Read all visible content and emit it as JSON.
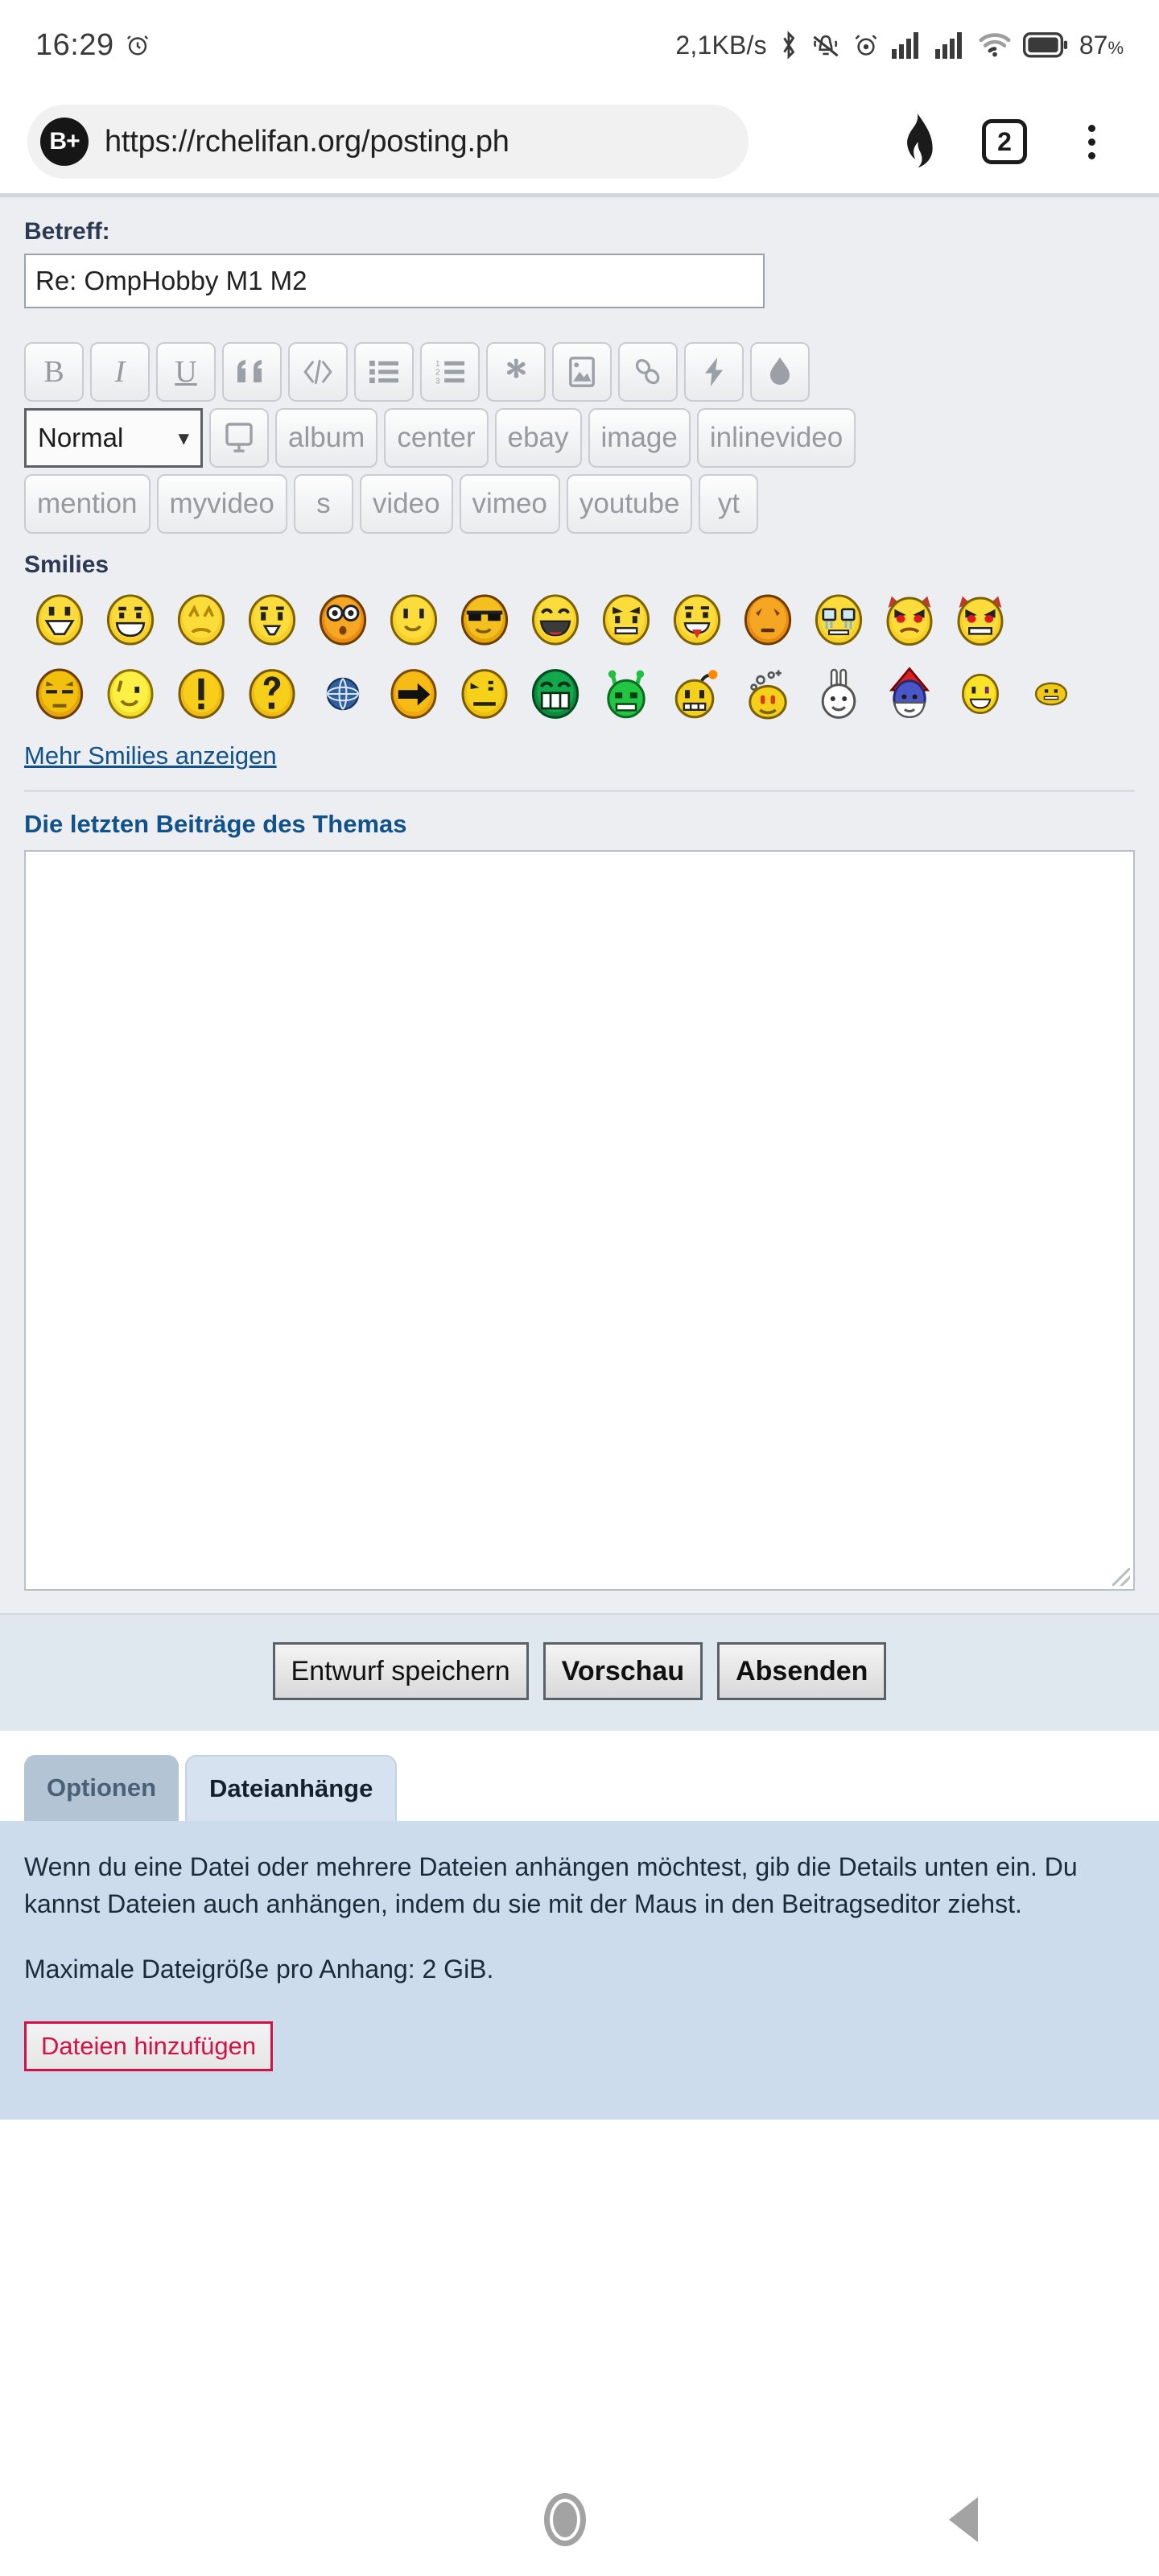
{
  "status_bar": {
    "time": "16:29",
    "alarm_icon": "alarm-clock-icon",
    "network_speed": "2,1KB/s",
    "icons": [
      "bluetooth-icon",
      "vibrate-off-icon",
      "alarm-icon",
      "signal-sim1-icon",
      "signal-sim2-icon",
      "wifi-icon",
      "battery-icon"
    ],
    "battery_percent": "87",
    "battery_percent_symbol": "%"
  },
  "browser": {
    "profile_badge": "B+",
    "url": "https://rchelifan.org/posting.ph",
    "shields_icon": "brave-shields-flame-icon",
    "tab_count": "2",
    "menu_icon": "kebab-menu-icon"
  },
  "form": {
    "subject_label": "Betreff:",
    "subject_value": "Re: OmpHobby M1 M2"
  },
  "toolbar": {
    "row1": [
      {
        "name": "bold-button",
        "glyph": "B"
      },
      {
        "name": "italic-button",
        "glyph": "I"
      },
      {
        "name": "underline-button",
        "glyph": "U"
      },
      {
        "name": "quote-button",
        "glyph": "“"
      },
      {
        "name": "code-button",
        "glyph": "</>"
      },
      {
        "name": "unordered-list-button",
        "glyph": "list"
      },
      {
        "name": "ordered-list-button",
        "glyph": "list-ordered"
      },
      {
        "name": "list-item-button",
        "glyph": "✳"
      },
      {
        "name": "image-button",
        "glyph": "image"
      },
      {
        "name": "url-link-button",
        "glyph": "link"
      },
      {
        "name": "flash-button",
        "glyph": "⚡"
      },
      {
        "name": "color-button",
        "glyph": "droplet"
      }
    ],
    "font_size_select": "Normal",
    "row2": [
      {
        "name": "screen-button",
        "glyph": "monitor"
      },
      {
        "name": "album-button",
        "glyph": "album"
      },
      {
        "name": "center-button",
        "glyph": "center"
      },
      {
        "name": "ebay-button",
        "glyph": "ebay"
      },
      {
        "name": "image-tag-button",
        "glyph": "image"
      },
      {
        "name": "inlinevideo-button",
        "glyph": "inlinevideo"
      }
    ],
    "row3": [
      {
        "name": "mention-button",
        "glyph": "mention"
      },
      {
        "name": "myvideo-button",
        "glyph": "myvideo"
      },
      {
        "name": "strike-button",
        "glyph": "s"
      },
      {
        "name": "video-button",
        "glyph": "video"
      },
      {
        "name": "vimeo-button",
        "glyph": "vimeo"
      },
      {
        "name": "youtube-button",
        "glyph": "youtube"
      },
      {
        "name": "yt-button",
        "glyph": "yt"
      }
    ]
  },
  "smilies": {
    "heading": "Smilies",
    "more_link": "Mehr Smilies anzeigen",
    "row1": [
      "smiley-big-grin",
      "smiley-grin",
      "smiley-sad",
      "smiley-tongue-out",
      "smiley-shocked",
      "smiley-smile",
      "smiley-cool",
      "smiley-laugh",
      "smiley-mad",
      "smiley-razz",
      "smiley-confused",
      "smiley-cry",
      "smiley-evil-angry",
      "smiley-evil-grin"
    ],
    "row2": [
      "smiley-roll-eyes",
      "smiley-wink",
      "smiley-exclaim",
      "smiley-question",
      "smiley-globe",
      "smiley-arrow",
      "smiley-neutral",
      "smiley-green-grin",
      "smiley-alien",
      "smiley-bomb",
      "smiley-bubbles",
      "smiley-bunny",
      "smiley-gnome",
      "smiley-yellow-smile",
      "smiley-flat"
    ]
  },
  "last_posts": {
    "heading": "Die letzten Beiträge des Themas"
  },
  "actions": {
    "save_draft": "Entwurf speichern",
    "preview": "Vorschau",
    "submit": "Absenden"
  },
  "tabs": [
    {
      "label": "Optionen",
      "active": false
    },
    {
      "label": "Dateianhänge",
      "active": true
    }
  ],
  "attachments": {
    "paragraph1": "Wenn du eine Datei oder mehrere Dateien anhängen möchtest, gib die Details unten ein. Du kannst Dateien auch anhängen, indem du sie mit der Maus in den Beitragseditor ziehst.",
    "paragraph2": "Maximale Dateigröße pro Anhang: 2 GiB.",
    "add_files_button": "Dateien hinzufügen"
  },
  "nav_bar": {
    "recents": "recents-square-icon",
    "home": "home-circle-icon",
    "back": "back-triangle-icon"
  },
  "colors": {
    "page_bg": "#eceef2",
    "link_blue": "#105289",
    "heading_blue": "#2b3a52",
    "attach_panel": "#ccdcec",
    "action_bar": "#dfe7ef",
    "accent_red": "#d31145"
  }
}
